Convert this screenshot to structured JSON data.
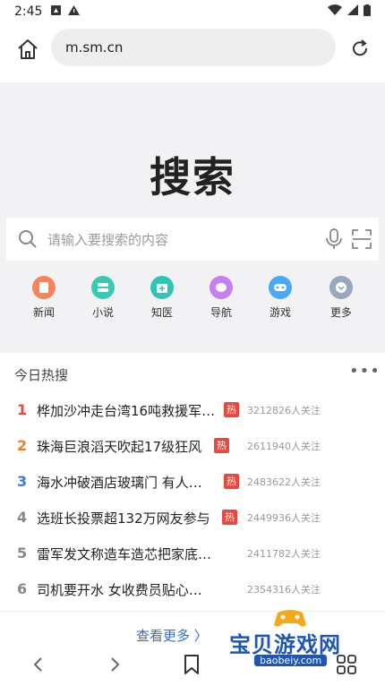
{
  "status": {
    "time": "2:45"
  },
  "browser": {
    "url": "m.sm.cn"
  },
  "hero": {
    "title": "搜索",
    "search_placeholder": "请输入要搜索的内容"
  },
  "quick_links": [
    {
      "label": "新闻",
      "icon": "news-icon",
      "color": "#f5845a"
    },
    {
      "label": "小说",
      "icon": "novel-icon",
      "color": "#3cc9b4"
    },
    {
      "label": "知医",
      "icon": "medical-icon",
      "color": "#2fc4b5"
    },
    {
      "label": "导航",
      "icon": "navigation-icon",
      "color": "#c57ff0"
    },
    {
      "label": "游戏",
      "icon": "game-icon",
      "color": "#4aa8f4"
    },
    {
      "label": "更多",
      "icon": "more-icon",
      "color": "#9aa8bf"
    }
  ],
  "hot": {
    "title": "今日热搜",
    "items": [
      {
        "rank": "1",
        "text": "桦加沙冲走台湾16吨救援军…",
        "badge": "热",
        "count": "3212826人关注"
      },
      {
        "rank": "2",
        "text": "珠海巨浪滔天吹起17级狂风",
        "badge": "热",
        "count": "2611940人关注"
      },
      {
        "rank": "3",
        "text": "海水冲破酒店玻璃门 有人…",
        "badge": "热",
        "count": "2483622人关注"
      },
      {
        "rank": "4",
        "text": "选班长投票超132万网友参与",
        "badge": "热",
        "count": "2449936人关注"
      },
      {
        "rank": "5",
        "text": "雷军发文称造车造芯把家底…",
        "badge": "",
        "count": "2411782人关注"
      },
      {
        "rank": "6",
        "text": "司机要开水 女收费员贴心…",
        "badge": "",
        "count": "2354316人关注"
      }
    ],
    "see_more": "查看更多 〉"
  },
  "watermark": {
    "text": "宝贝游戏网",
    "url": "baobeiy.com"
  },
  "colors": {
    "rank1": "#e8483d",
    "rank2": "#f07c2a",
    "rank3": "#3d7ad8",
    "rank_other": "#888888",
    "link": "#2f6ecf"
  }
}
